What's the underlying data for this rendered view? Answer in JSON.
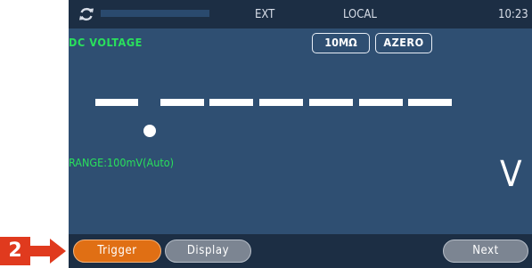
{
  "callout": {
    "number": "2",
    "color": "#e03a1e"
  },
  "status_bar": {
    "trigger_source": "EXT",
    "remote_state": "LOCAL",
    "time": "10:23",
    "icons": [
      "refresh-icon"
    ]
  },
  "measurement": {
    "function": "DC VOLTAGE",
    "impedance_label": "10MΩ",
    "autozero_label": "AZERO",
    "reading_digits": 7,
    "range_text": "RANGE:100mV(Auto)",
    "unit": "V"
  },
  "softkeys": {
    "trigger": "Trigger",
    "display": "Display",
    "next": "Next"
  },
  "colors": {
    "screen_bg": "#2f4f72",
    "bar_bg": "#1c2e44",
    "label_green": "#29e05c",
    "active_softkey": "#e06f14",
    "inactive_softkey": "#7c8592"
  }
}
